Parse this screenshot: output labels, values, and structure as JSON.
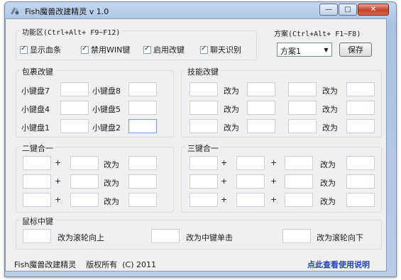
{
  "window": {
    "title": "Fish魔兽改建精灵 v 1.0",
    "minimize_glyph": "—",
    "maximize_glyph": "□",
    "close_glyph": "✕"
  },
  "function_area": {
    "title": "功能区(Ctrl+Alt+ F9~F12)",
    "checkboxes": [
      {
        "label": "显示血条",
        "checked": true
      },
      {
        "label": "禁用WIN键",
        "checked": true
      },
      {
        "label": "启用改键",
        "checked": true
      },
      {
        "label": "聊天识别",
        "checked": true
      }
    ]
  },
  "scheme": {
    "title": "方案(Ctrl+Alt+ F1~F8)",
    "selected": "方案1",
    "save_label": "保存"
  },
  "inventory": {
    "title": "包裹改键",
    "labels": [
      "小键盘7",
      "小键盘8",
      "小键盘4",
      "小键盘5",
      "小键盘1",
      "小键盘2"
    ]
  },
  "skill": {
    "title": "技能改键",
    "change_to": "改为"
  },
  "two_keys": {
    "title": "二键合一",
    "plus": "+",
    "change_to": "改为"
  },
  "three_keys": {
    "title": "三键合一",
    "plus": "+",
    "change_to": "改为"
  },
  "mouse": {
    "title": "鼠标中键",
    "options": [
      "改为滚轮向上",
      "改为中键单击",
      "改为滚轮向下"
    ]
  },
  "footer": {
    "copyright": "Fish魔兽改建精灵    版权所有  (C) 2011",
    "help_link": "点此查看使用说明"
  }
}
